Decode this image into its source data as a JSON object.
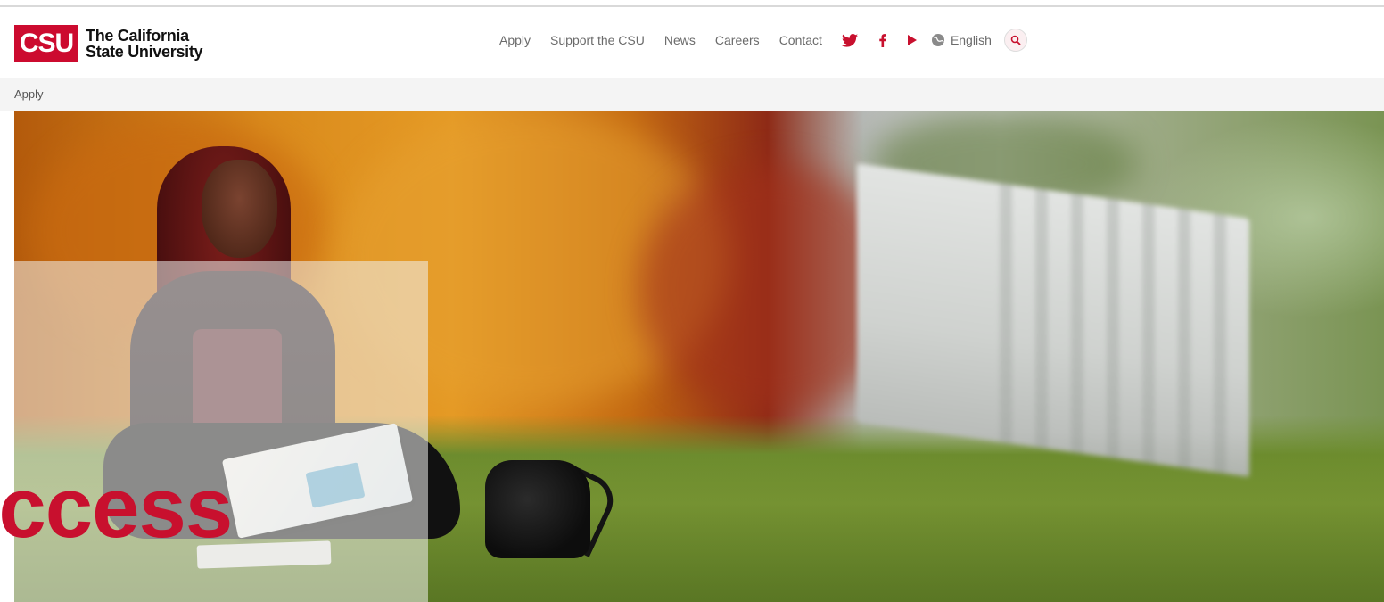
{
  "brand": {
    "mark": "CSU",
    "line1": "The California",
    "line2": "State University",
    "color": "#cc0b2f"
  },
  "nav": {
    "items": [
      "Apply",
      "Support the CSU",
      "News",
      "Careers",
      "Contact"
    ],
    "social": [
      "twitter-icon",
      "facebook-icon",
      "youtube-icon"
    ],
    "language": "English",
    "search_icon": "search-icon"
  },
  "breadcrumb": {
    "current": "Apply"
  },
  "hero": {
    "heading": "Access",
    "heading_color": "#c8102e"
  }
}
